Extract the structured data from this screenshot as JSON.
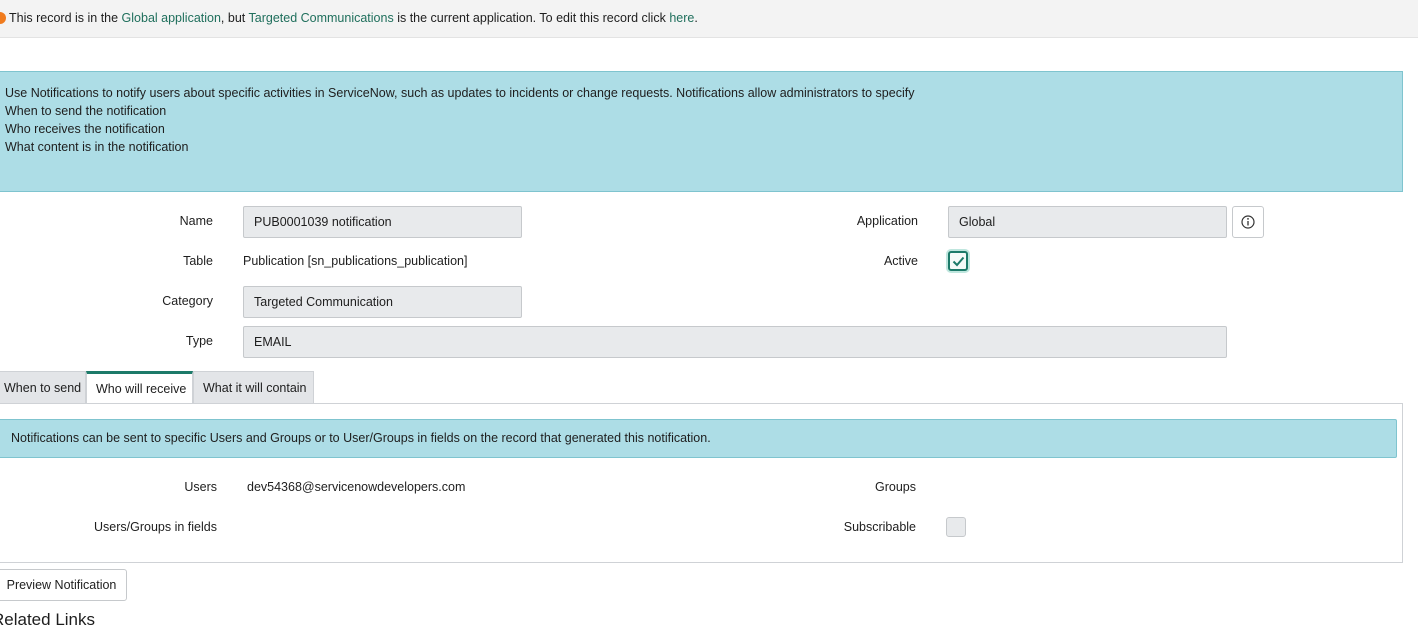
{
  "banner": {
    "prefix": "This record is in the ",
    "scope_link": "Global application",
    "middle": ", but ",
    "current_app_link": "Targeted Communications",
    "suffix": " is the current application. To edit this record click ",
    "edit_link": "here",
    "end": "."
  },
  "info": {
    "line1": "Use Notifications to notify users about specific activities in ServiceNow, such as updates to incidents or change requests. Notifications allow administrators to specify",
    "line2": "When to send the notification",
    "line3": "Who receives the notification",
    "line4": "What content is in the notification"
  },
  "form": {
    "name_label": "Name",
    "name_value": "PUB0001039 notification",
    "table_label": "Table",
    "table_value": "Publication [sn_publications_publication]",
    "category_label": "Category",
    "category_value": "Targeted Communication",
    "type_label": "Type",
    "type_value": "EMAIL",
    "application_label": "Application",
    "application_value": "Global",
    "active_label": "Active",
    "active_checked": true
  },
  "tabs": [
    {
      "label": "When to send"
    },
    {
      "label": "Who will receive",
      "selected": true
    },
    {
      "label": "What it will contain"
    }
  ],
  "recipients": {
    "notice": "Notifications can be sent to specific Users and Groups or to User/Groups in fields on the record that generated this notification.",
    "users_label": "Users",
    "users_value": "dev54368@servicenowdevelopers.com",
    "groups_label": "Groups",
    "groups_value": "",
    "fields_label": "Users/Groups in fields",
    "subscribable_label": "Subscribable",
    "subscribable_checked": false
  },
  "actions": {
    "preview_label": "Preview Notification"
  },
  "related": {
    "heading": "Related Links"
  },
  "colors": {
    "accent": "#1c7a69",
    "info_bg": "#addde6",
    "field_bg": "#e8eaec",
    "warning_dot": "#f07b1e"
  },
  "icons": {
    "warning": "warning-dot-icon",
    "info": "info-circle-icon",
    "check": "checkmark-icon"
  }
}
